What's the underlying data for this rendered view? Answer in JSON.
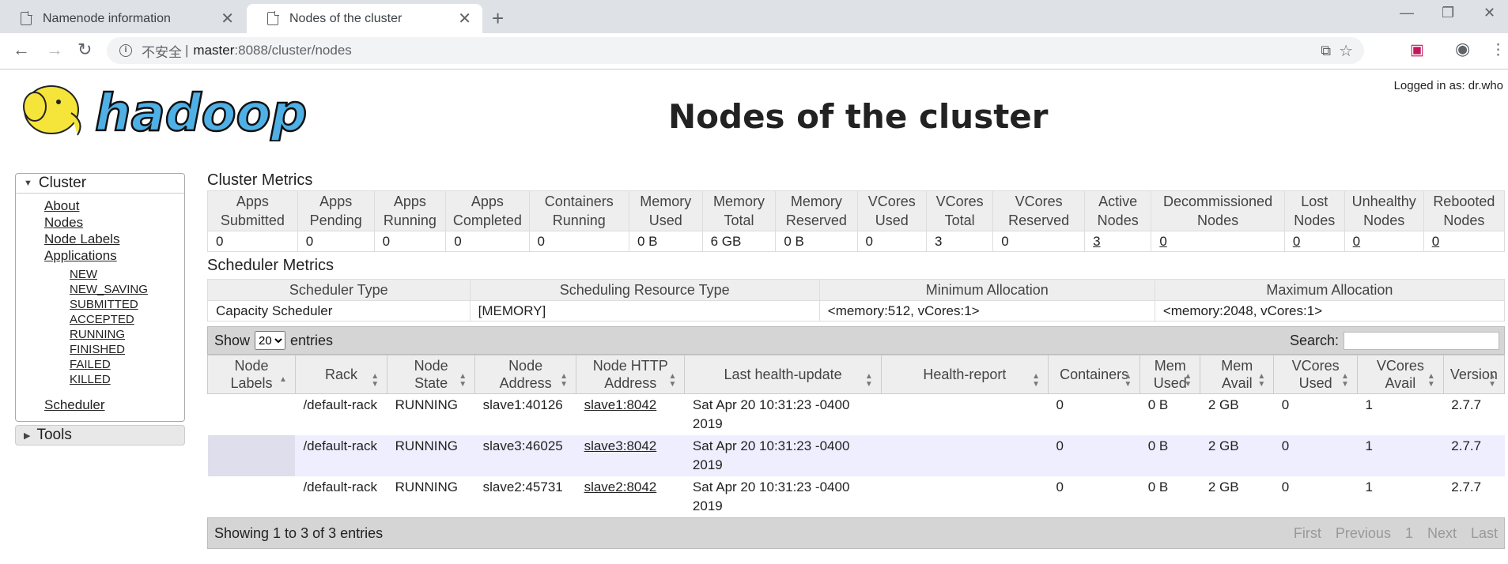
{
  "browser": {
    "tabs": [
      {
        "label": "Namenode information"
      },
      {
        "label": "Nodes of the cluster"
      }
    ],
    "address": {
      "insecure_label": "不安全",
      "separator": "|",
      "host": "master",
      "path": ":8088/cluster/nodes"
    }
  },
  "header": {
    "title": "Nodes of the cluster",
    "logged_in": "Logged in as: dr.who",
    "logo_text": "hadoop"
  },
  "sidebar": {
    "cluster_label": "Cluster",
    "links": [
      "About",
      "Nodes",
      "Node Labels",
      "Applications"
    ],
    "app_states": [
      "NEW",
      "NEW_SAVING",
      "SUBMITTED",
      "ACCEPTED",
      "RUNNING",
      "FINISHED",
      "FAILED",
      "KILLED"
    ],
    "scheduler_label": "Scheduler",
    "tools_label": "Tools"
  },
  "cluster_metrics": {
    "title": "Cluster Metrics",
    "headers": [
      [
        "Apps",
        "Submitted"
      ],
      [
        "Apps",
        "Pending"
      ],
      [
        "Apps",
        "Running"
      ],
      [
        "Apps",
        "Completed"
      ],
      [
        "Containers",
        "Running"
      ],
      [
        "Memory",
        "Used"
      ],
      [
        "Memory",
        "Total"
      ],
      [
        "Memory",
        "Reserved"
      ],
      [
        "VCores",
        "Used"
      ],
      [
        "VCores",
        "Total"
      ],
      [
        "VCores",
        "Reserved"
      ],
      [
        "Active",
        "Nodes"
      ],
      [
        "Decommissioned",
        "Nodes"
      ],
      [
        "Lost",
        "Nodes"
      ],
      [
        "Unhealthy",
        "Nodes"
      ],
      [
        "Rebooted",
        "Nodes"
      ]
    ],
    "values": [
      "0",
      "0",
      "0",
      "0",
      "0",
      "0 B",
      "6 GB",
      "0 B",
      "0",
      "3",
      "0",
      "3",
      "0",
      "0",
      "0",
      "0"
    ]
  },
  "scheduler_metrics": {
    "title": "Scheduler Metrics",
    "headers": [
      "Scheduler Type",
      "Scheduling Resource Type",
      "Minimum Allocation",
      "Maximum Allocation"
    ],
    "values": [
      "Capacity Scheduler",
      "[MEMORY]",
      "<memory:512, vCores:1>",
      "<memory:2048, vCores:1>"
    ]
  },
  "nodes_table": {
    "show_label": "Show",
    "entries_value": "20",
    "entries_label": "entries",
    "search_label": "Search:",
    "headers": [
      [
        "Node",
        "Labels"
      ],
      [
        "Rack",
        ""
      ],
      [
        "Node",
        "State"
      ],
      [
        "Node",
        "Address"
      ],
      [
        "Node HTTP",
        "Address"
      ],
      [
        "Last health-update",
        ""
      ],
      [
        "Health-report",
        ""
      ],
      [
        "Containers",
        ""
      ],
      [
        "Mem",
        "Used"
      ],
      [
        "Mem",
        "Avail"
      ],
      [
        "VCores",
        "Used"
      ],
      [
        "VCores",
        "Avail"
      ],
      [
        "Version",
        ""
      ]
    ],
    "rows": [
      {
        "labels": "",
        "rack": "/default-rack",
        "state": "RUNNING",
        "address": "slave1:40126",
        "http": "slave1:8042",
        "health_update": "Sat Apr 20 10:31:23 -0400 2019",
        "health_report": "",
        "containers": "0",
        "mem_used": "0 B",
        "mem_avail": "2 GB",
        "vc_used": "0",
        "vc_avail": "1",
        "version": "2.7.7"
      },
      {
        "labels": "",
        "rack": "/default-rack",
        "state": "RUNNING",
        "address": "slave3:46025",
        "http": "slave3:8042",
        "health_update": "Sat Apr 20 10:31:23 -0400 2019",
        "health_report": "",
        "containers": "0",
        "mem_used": "0 B",
        "mem_avail": "2 GB",
        "vc_used": "0",
        "vc_avail": "1",
        "version": "2.7.7"
      },
      {
        "labels": "",
        "rack": "/default-rack",
        "state": "RUNNING",
        "address": "slave2:45731",
        "http": "slave2:8042",
        "health_update": "Sat Apr 20 10:31:23 -0400 2019",
        "health_report": "",
        "containers": "0",
        "mem_used": "0 B",
        "mem_avail": "2 GB",
        "vc_used": "0",
        "vc_avail": "1",
        "version": "2.7.7"
      }
    ],
    "footer": "Showing 1 to 3 of 3 entries",
    "pager": [
      "First",
      "Previous",
      "1",
      "Next",
      "Last"
    ]
  },
  "colors": {
    "logo_blue": "#4fb0e6",
    "logo_yellow": "#f5e43a",
    "row_alt": "#eeeeff"
  }
}
